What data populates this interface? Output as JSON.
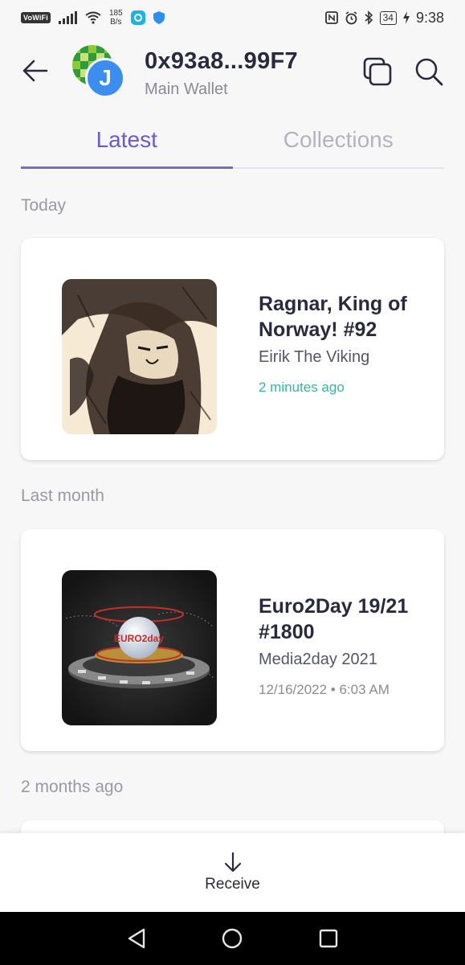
{
  "status_bar": {
    "vowifi": "VoWiFi",
    "net_speed_value": "185",
    "net_speed_unit": "B/s",
    "battery": "34",
    "time": "9:38"
  },
  "header": {
    "back_icon": "arrow-left-icon",
    "avatar_letter": "J",
    "wallet_address": "0x93a8...99F7",
    "wallet_name": "Main Wallet",
    "copy_icon": "copy-icon",
    "search_icon": "search-icon"
  },
  "tabs": [
    {
      "label": "Latest",
      "active": true
    },
    {
      "label": "Collections",
      "active": false
    }
  ],
  "sections": [
    {
      "label": "Today",
      "items": [
        {
          "title": "Ragnar, King of Norway! #92",
          "collection": "Eirik The Viking",
          "time": "2 minutes ago"
        }
      ]
    },
    {
      "label": "Last month",
      "items": [
        {
          "title": "Euro2Day 19/21 #1800",
          "collection": "Media2day 2021",
          "time": "12/16/2022 • 6:03 AM",
          "image_text": "EURO2day"
        }
      ]
    },
    {
      "label": "2 months ago",
      "items": []
    }
  ],
  "bottom_bar": {
    "receive_label": "Receive",
    "receive_icon": "arrow-down-icon"
  },
  "colors": {
    "accent": "#7a68d4",
    "time_green": "#35b3a4",
    "avatar_blue": "#3b8df0"
  }
}
